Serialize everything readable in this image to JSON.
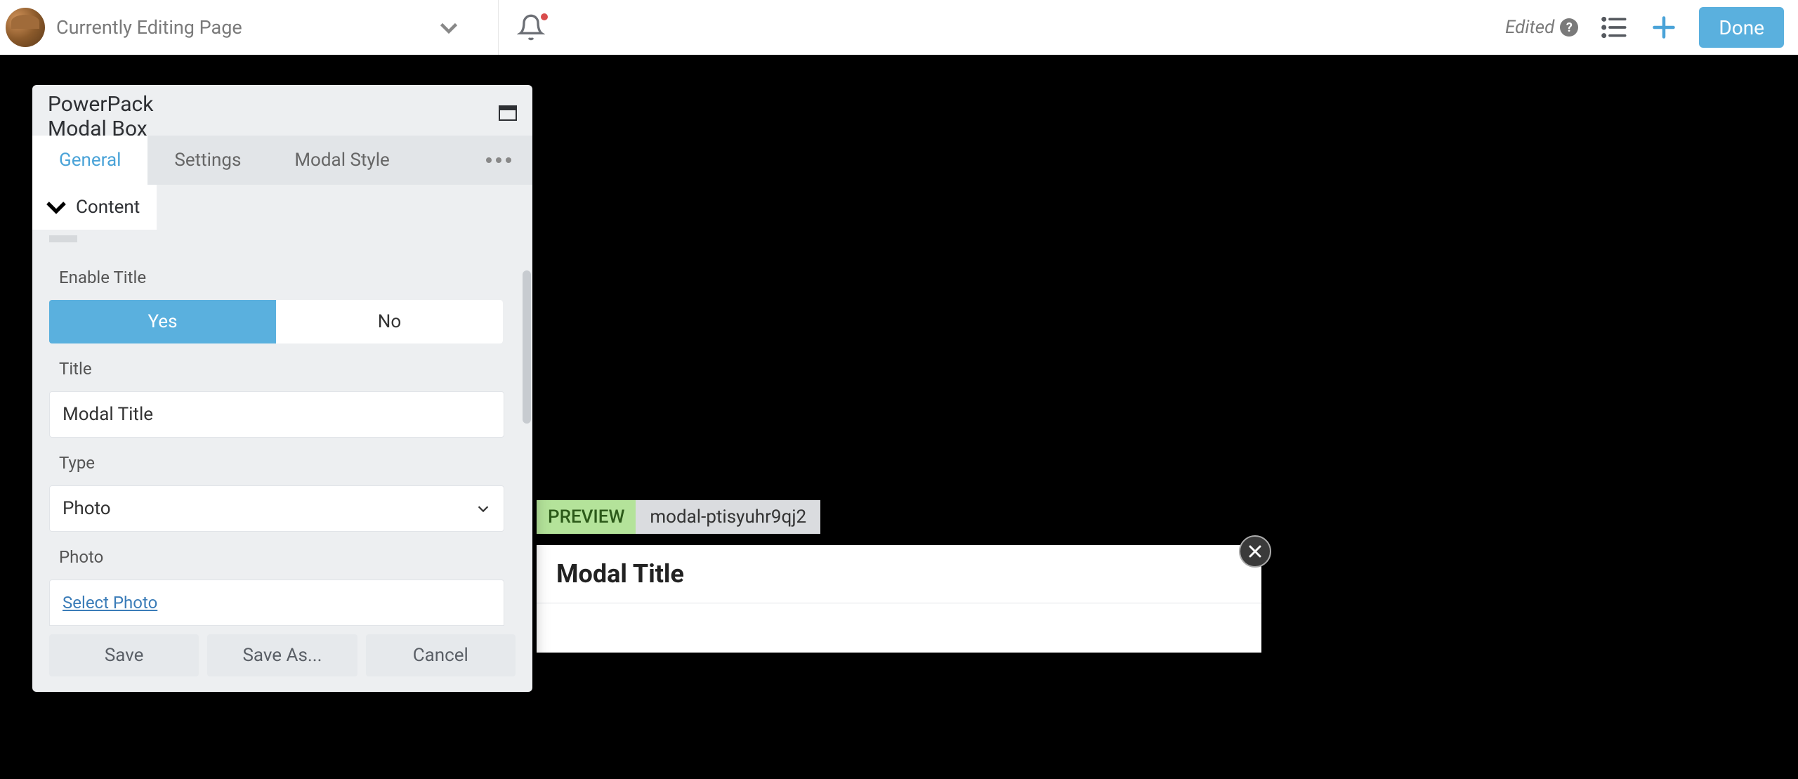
{
  "topbar": {
    "logo_alt": "Builder logo",
    "page_label": "Currently Editing Page",
    "edited_label": "Edited",
    "done_label": "Done"
  },
  "panel": {
    "title": "PowerPack Modal Box",
    "tabs": {
      "general": "General",
      "settings": "Settings",
      "style": "Modal Style"
    },
    "section": "Content",
    "fields": {
      "enable_title_label": "Enable Title",
      "yes_label": "Yes",
      "no_label": "No",
      "title_label": "Title",
      "title_value": "Modal Title",
      "type_label": "Type",
      "type_value": "Photo",
      "photo_label": "Photo",
      "select_photo": "Select Photo"
    },
    "actions": {
      "save": "Save",
      "save_as": "Save As...",
      "cancel": "Cancel"
    }
  },
  "preview": {
    "label": "PREVIEW",
    "id": "modal-ptisyuhr9qj2",
    "modal_title": "Modal Title"
  }
}
